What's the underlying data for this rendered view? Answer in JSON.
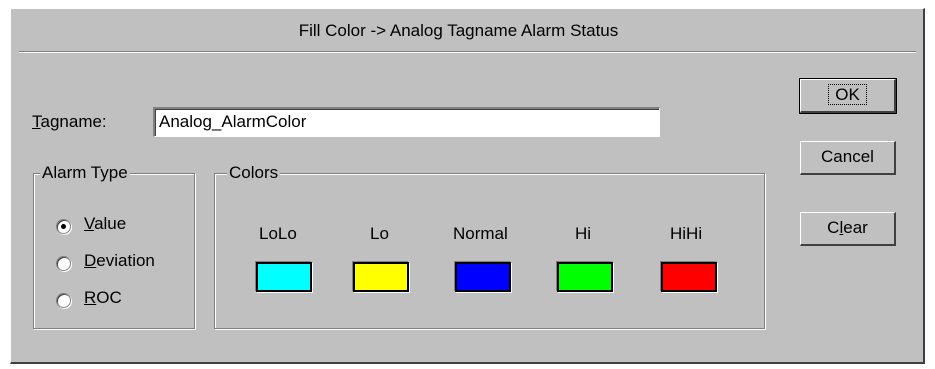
{
  "dialog": {
    "title": "Fill Color -> Analog Tagname Alarm Status"
  },
  "tagname": {
    "label_underlined": "T",
    "label_rest": "agname:",
    "value": "Analog_AlarmColor"
  },
  "alarm_type": {
    "title": "Alarm Type",
    "options": [
      {
        "underlined": "V",
        "rest": "alue",
        "selected": true
      },
      {
        "underlined": "D",
        "rest": "eviation",
        "selected": false
      },
      {
        "underlined": "R",
        "rest": "OC",
        "selected": false
      }
    ]
  },
  "colors": {
    "title": "Colors",
    "items": [
      {
        "label": "LoLo",
        "color": "#00ffff"
      },
      {
        "label": "Lo",
        "color": "#ffff00"
      },
      {
        "label": "Normal",
        "color": "#0000ff"
      },
      {
        "label": "Hi",
        "color": "#00ff00"
      },
      {
        "label": "HiHi",
        "color": "#ff0000"
      }
    ]
  },
  "buttons": {
    "ok": "OK",
    "cancel": "Cancel",
    "clear_underlined": "l",
    "clear_pre": "C",
    "clear_post": "ear"
  }
}
